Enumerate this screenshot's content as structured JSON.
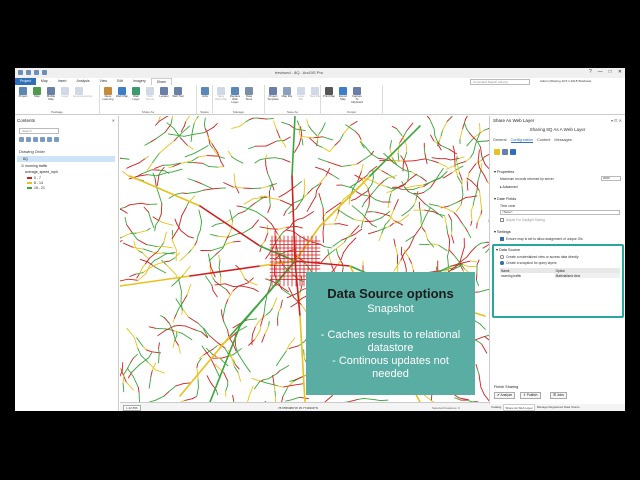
{
  "window": {
    "title": "trevbond - 8Q - ArcGIS Pro",
    "controls": [
      "?",
      "—",
      "□",
      "✕"
    ],
    "command_search_placeholder": "Command Search (Alt+Q)",
    "user": "Admin (Sharing 10.5 1.2018 Windows)"
  },
  "tabs": [
    "Project",
    "Map",
    "Insert",
    "Analysis",
    "View",
    "Edit",
    "Imagery",
    "Share"
  ],
  "ribbon": {
    "groups": [
      {
        "label": "Package",
        "buttons": [
          {
            "label": "Project",
            "color": "#5b86b8",
            "dim": false
          },
          {
            "label": "Map",
            "color": "#4d9a4d",
            "dim": false
          },
          {
            "label": "Mobile Map",
            "color": "#6a7fa8",
            "dim": false
          },
          {
            "label": "Layer",
            "color": "#8aa0be",
            "dim": true
          },
          {
            "label": "Geoprocessing",
            "color": "#8aa0be",
            "dim": true
          }
        ]
      },
      {
        "label": "Share As",
        "buttons": [
          {
            "label": "Deep Learning",
            "color": "#c68a3d",
            "dim": false
          },
          {
            "label": "Web Map",
            "color": "#3d7fc6",
            "dim": false
          },
          {
            "label": "Web Layer",
            "color": "#3d9a6f",
            "dim": false
          },
          {
            "label": "Web Scene",
            "color": "#8aa0be",
            "dim": true
          },
          {
            "label": "Locator",
            "color": "#6a7fa8",
            "dim": false
          },
          {
            "label": "Web Tool",
            "color": "#6a7fa8",
            "dim": false
          }
        ]
      },
      {
        "label": "Status",
        "buttons": [
          {
            "label": "Jobs",
            "color": "#5b86b8",
            "dim": false
          }
        ]
      },
      {
        "label": "Manage",
        "buttons": [
          {
            "label": "Save Web Map",
            "color": "#8aa0be",
            "dim": true
          },
          {
            "label": "Replace Web Layer",
            "color": "#5b86b8",
            "dim": false
          },
          {
            "label": "Data Store",
            "color": "#7a8ea8",
            "dim": false
          }
        ]
      },
      {
        "label": "Save As",
        "buttons": [
          {
            "label": "Project Template",
            "color": "#6a7fa8",
            "dim": false
          },
          {
            "label": "Map File",
            "color": "#8aa0be",
            "dim": false
          },
          {
            "label": "Layer File",
            "color": "#8aa0be",
            "dim": true
          },
          {
            "label": "Task File",
            "color": "#8aa0be",
            "dim": true
          }
        ]
      },
      {
        "label": "Output",
        "buttons": [
          {
            "label": "Print Map",
            "color": "#555555",
            "dim": false
          },
          {
            "label": "Export Map",
            "color": "#3d7fc6",
            "dim": false
          },
          {
            "label": "Capture To Clipboard",
            "color": "#6a7fa8",
            "dim": false
          }
        ]
      }
    ]
  },
  "contents": {
    "title": "Contents",
    "search_placeholder": "Search",
    "drawing_order": "Drawing Order",
    "map_name": "8Q",
    "layer": "morning traffic",
    "field": "average_speed_mph",
    "legend": [
      {
        "label": "0 - 7",
        "color": "#d11f1f"
      },
      {
        "label": "8 - 14",
        "color": "#e8c21c"
      },
      {
        "label": "15 - 21",
        "color": "#3aa63a"
      }
    ]
  },
  "map_status": {
    "scale": "1:42,556",
    "coordinates": "78.6556980°W 35.7749309°N",
    "selected": "Selected Features: 0"
  },
  "overlay": {
    "title": "Data Source options",
    "subtitle": "Snapshot",
    "bullets": [
      "- Caches results to relational",
      "datastore",
      "- Continous updates not",
      "needed"
    ]
  },
  "share_pane": {
    "title": "Share As Web Layer",
    "subtitle": "Sharing 8Q As A Web Layer",
    "tabs": [
      "General",
      "Configuration",
      "Content",
      "Messages"
    ],
    "active_tab": "Configuration",
    "properties": {
      "heading": "Properties",
      "max_records_label": "Maximum records returned by server",
      "max_records_value": "2000",
      "advanced": "Advanced"
    },
    "date_fields": {
      "heading": "Date Fields",
      "time_zone_label": "Time zone",
      "time_zone_value": "<None>",
      "daylight_label": "Adjust For Daylight Saving"
    },
    "settings": {
      "heading": "Settings",
      "unique_ids_label": "Ensure map is set to allow assignment of unique IDs"
    },
    "data_source": {
      "heading": "Data Source",
      "option_direct": "Create a materialized view or access data directly",
      "option_snapshot": "Create a snapshot for query layers",
      "table_headers": [
        "Name",
        "Option"
      ],
      "rows": [
        [
          "morning traffic",
          "Materialized view"
        ]
      ]
    },
    "finish": {
      "heading": "Finish Sharing",
      "analyze": "Analyze",
      "publish": "Publish",
      "jobs": "Jobs"
    }
  },
  "bottom_tabs": [
    "Catalog",
    "Share As Web Layer",
    "Manage Registered Data Stores"
  ],
  "bottom_tabs_active": "Share As Web Layer"
}
